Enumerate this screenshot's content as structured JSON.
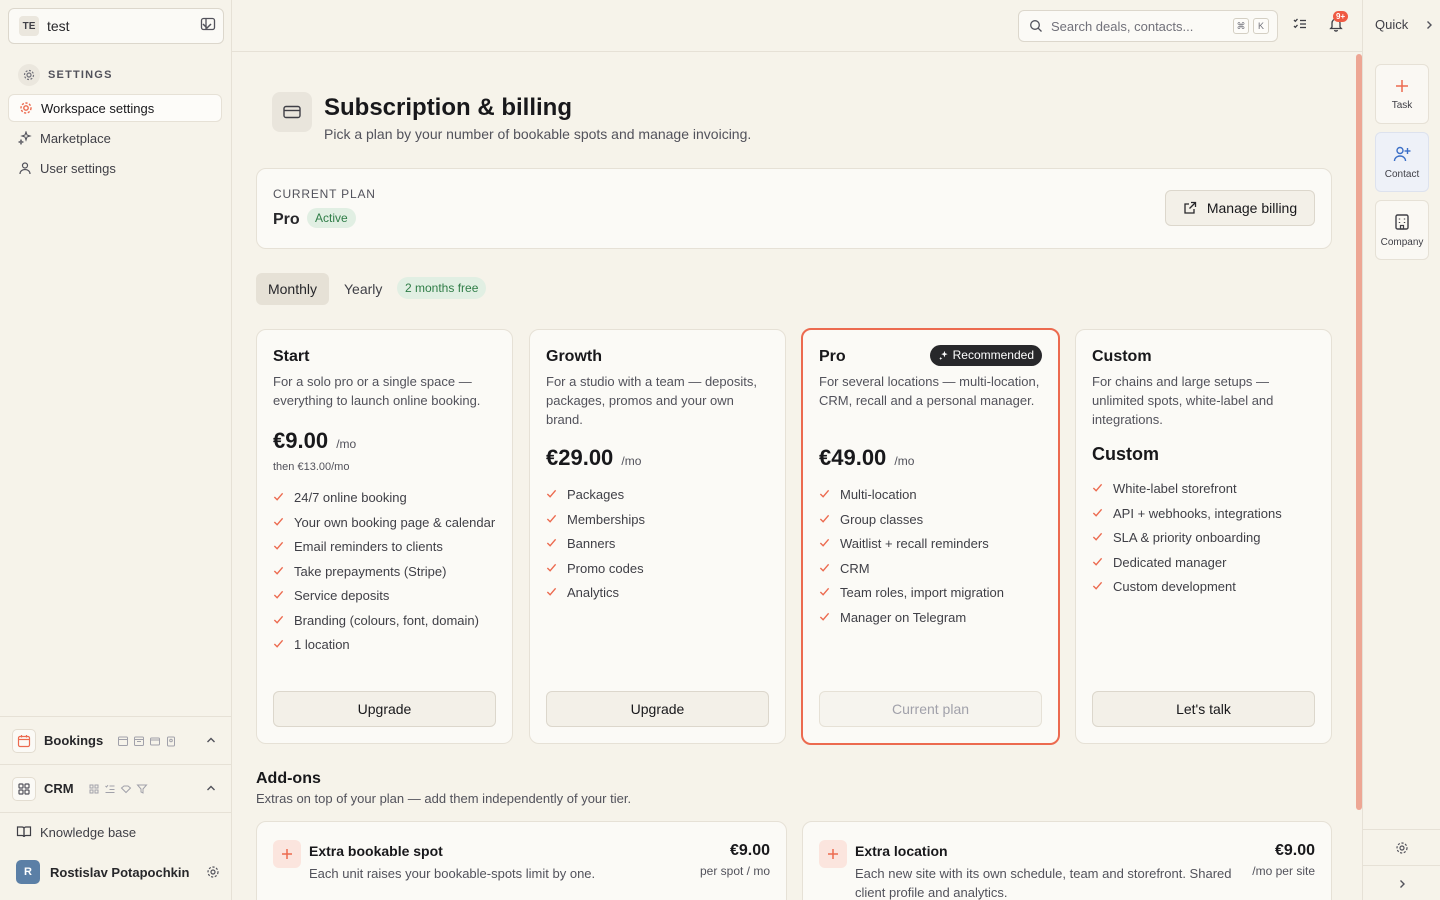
{
  "workspace": {
    "badge": "TE",
    "name": "test"
  },
  "sidebar": {
    "section_label": "SETTINGS",
    "items": [
      {
        "label": "Workspace settings",
        "icon": "gear-icon"
      },
      {
        "label": "Marketplace",
        "icon": "sparkles-icon"
      },
      {
        "label": "User settings",
        "icon": "user-icon"
      }
    ],
    "modules": [
      {
        "label": "Bookings",
        "icon": "calendar-icon"
      },
      {
        "label": "CRM",
        "icon": "grid-icon"
      }
    ],
    "knowledge_base": "Knowledge base",
    "user": {
      "initial": "R",
      "name": "Rostislav Potapochkin"
    }
  },
  "topbar": {
    "search_placeholder": "Search deals, contacts...",
    "kbd_cmd": "⌘",
    "kbd_k": "K",
    "notif_count": "9+"
  },
  "rail": {
    "quick_label": "Quick",
    "buttons": [
      {
        "label": "Task",
        "icon": "plus-icon"
      },
      {
        "label": "Contact",
        "icon": "user-plus-icon"
      },
      {
        "label": "Company",
        "icon": "building-icon"
      }
    ]
  },
  "page": {
    "title": "Subscription & billing",
    "subtitle": "Pick a plan by your number of bookable spots and manage invoicing."
  },
  "current_plan": {
    "label": "CURRENT PLAN",
    "name": "Pro",
    "status": "Active",
    "manage_label": "Manage billing"
  },
  "billing_toggle": {
    "monthly": "Monthly",
    "yearly": "Yearly",
    "yearly_badge": "2 months free",
    "selected": "Monthly"
  },
  "plans": [
    {
      "name": "Start",
      "description": "For a solo pro or a single space — everything to launch online booking.",
      "price": "€9.00",
      "per": "/mo",
      "then": "then €13.00/mo",
      "features": [
        "24/7 online booking",
        "Your own booking page & calendar",
        "Email reminders to clients",
        "Take prepayments (Stripe)",
        "Service deposits",
        "Branding (colours, font, domain)",
        "1 location"
      ],
      "button": "Upgrade"
    },
    {
      "name": "Growth",
      "description": "For a studio with a team — deposits, packages, promos and your own brand.",
      "price": "€29.00",
      "per": "/mo",
      "features": [
        "Packages",
        "Memberships",
        "Banners",
        "Promo codes",
        "Analytics"
      ],
      "button": "Upgrade"
    },
    {
      "name": "Pro",
      "badge": "Recommended",
      "description": "For several locations — multi-location, CRM, recall and a personal manager.",
      "price": "€49.00",
      "per": "/mo",
      "features": [
        "Multi-location",
        "Group classes",
        "Waitlist + recall reminders",
        "CRM",
        "Team roles, import migration",
        "Manager on Telegram"
      ],
      "button": "Current plan"
    },
    {
      "name": "Custom",
      "description": "For chains and large setups — unlimited spots, white-label and integrations.",
      "price": "Custom",
      "features": [
        "White-label storefront",
        "API + webhooks, integrations",
        "SLA & priority onboarding",
        "Dedicated manager",
        "Custom development"
      ],
      "button": "Let's talk"
    }
  ],
  "addons": {
    "title": "Add-ons",
    "subtitle": "Extras on top of your plan — add them independently of your tier.",
    "items": [
      {
        "name": "Extra bookable spot",
        "description": "Each unit raises your bookable-spots limit by one.",
        "price": "€9.00",
        "unit": "per spot / mo"
      },
      {
        "name": "Extra location",
        "description": "Each new site with its own schedule, team and storefront. Shared client profile and analytics.",
        "price": "€9.00",
        "unit": "/mo per site"
      }
    ]
  },
  "colors": {
    "accent": "#ec6a4f",
    "success_bg": "#e1efe3",
    "success_text": "#2f7d47",
    "background": "#f6f3ea"
  }
}
